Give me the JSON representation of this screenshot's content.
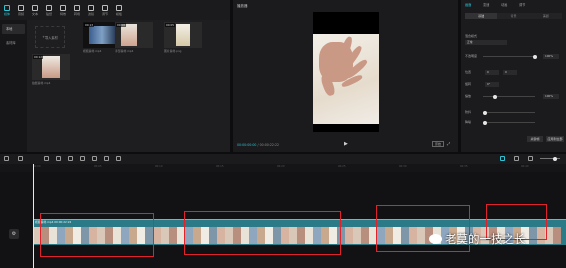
{
  "toolbar": {
    "tools": [
      {
        "label": "媒体",
        "icon": "media-icon",
        "active": true
      },
      {
        "label": "音频",
        "icon": "audio-icon"
      },
      {
        "label": "文本",
        "icon": "text-icon"
      },
      {
        "label": "贴纸",
        "icon": "sticker-icon"
      },
      {
        "label": "特效",
        "icon": "effects-icon"
      },
      {
        "label": "转场",
        "icon": "transition-icon"
      },
      {
        "label": "滤镜",
        "icon": "filter-icon"
      },
      {
        "label": "调节",
        "icon": "adjust-icon"
      },
      {
        "label": "模板",
        "icon": "template-icon"
      }
    ]
  },
  "sidebar": {
    "items": [
      {
        "label": "本地"
      },
      {
        "label": "素材库"
      }
    ]
  },
  "media": {
    "import_label": "导入素材",
    "clips": [
      {
        "name": "视频素材.mp4",
        "duration": "00:13"
      },
      {
        "name": "手部素材.mp4",
        "duration": "00:08"
      },
      {
        "name": "图片素材.png",
        "duration": "00:05"
      },
      {
        "name": "拍摄素材.mp4",
        "duration": "00:12"
      }
    ]
  },
  "player": {
    "title": "播放器",
    "timecode_current": "00:00:00:00",
    "timecode_total": "00:00:22:22",
    "ratio_label": "原始"
  },
  "properties": {
    "tabs": [
      {
        "label": "画面",
        "active": true
      },
      {
        "label": "变速"
      },
      {
        "label": "动画"
      },
      {
        "label": "调节"
      }
    ],
    "subtabs": [
      {
        "label": "基础",
        "active": true
      },
      {
        "label": "背景"
      },
      {
        "label": "美颜"
      }
    ],
    "blend_label": "混合模式",
    "blend_value": "正常",
    "opacity_label": "不透明度",
    "opacity_value": "100%",
    "position_label": "位置",
    "position_x": "0",
    "position_y": "0",
    "rotate_label": "旋转",
    "rotate_value": "0°",
    "scale_label": "缩放",
    "scale_value": "100%",
    "stabilize_label": "防抖",
    "denoise_label": "降噪",
    "keyframe_button": "关键帧",
    "apply_all_button": "应用到全部"
  },
  "timeline": {
    "clip_label": "视频素材.mp4  00:00:22:22",
    "ticks": [
      "00:00",
      "00:05",
      "00:10",
      "00:15",
      "00:20",
      "00:25",
      "00:30",
      "00:35",
      "00:40"
    ],
    "watermark": "老莫的一技之长"
  },
  "colors": {
    "accent": "#2dc5d6",
    "clip": "#2a7b87",
    "marker": "#e0222b"
  }
}
